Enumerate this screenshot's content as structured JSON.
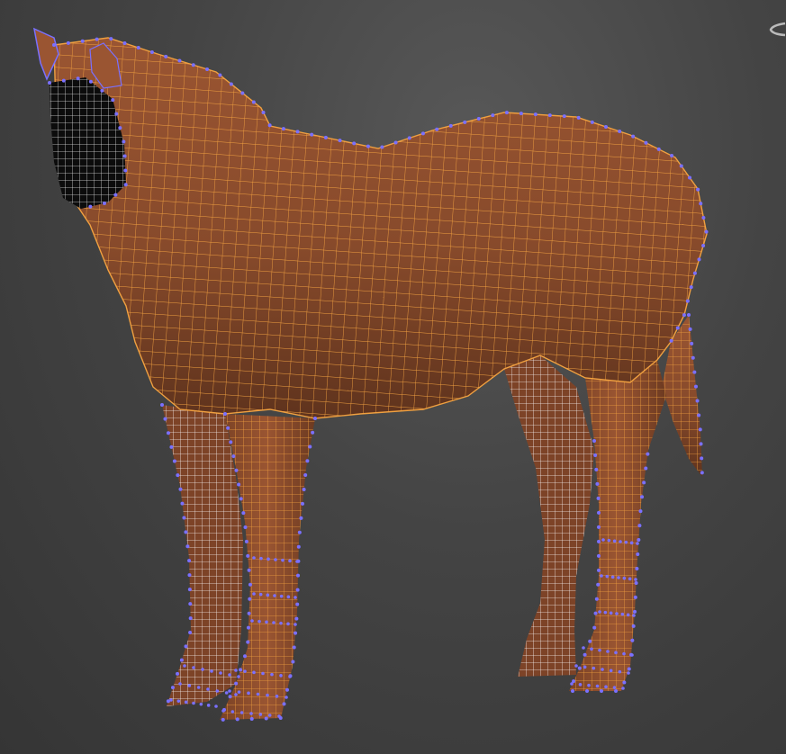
{
  "viewport": {
    "background_color": "#444444",
    "mesh_surface_color": "#8a4a2c",
    "wire_color_front": "#f0a040",
    "wire_color_back": "#ffffff",
    "vertex_color": "#7a70ff",
    "nav_icon": "viewcube-ring-icon"
  },
  "model": {
    "subject": "horse-icon",
    "display_mode": "shaded-with-wireframe",
    "vertices_shown": true
  }
}
